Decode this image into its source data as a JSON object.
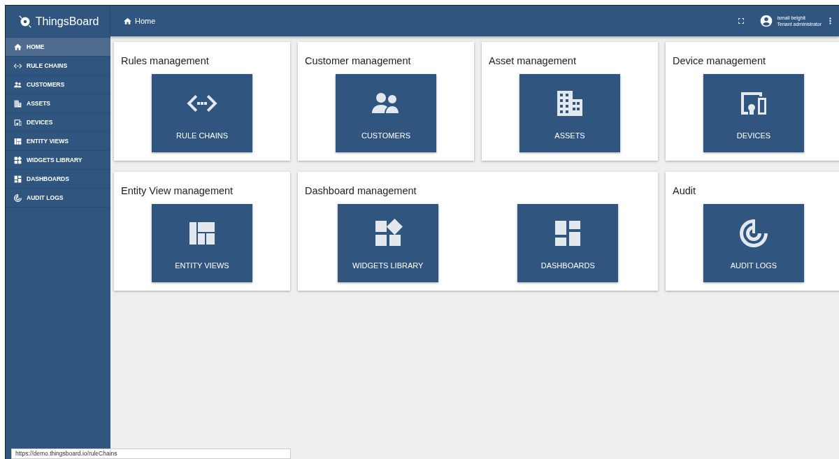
{
  "app": {
    "title": "ThingsBoard"
  },
  "breadcrumb": {
    "label": "Home"
  },
  "user": {
    "name": "ismail belghit",
    "role": "Tenant administrator"
  },
  "sidebar": {
    "items": [
      {
        "label": "HOME",
        "kind": "home",
        "selected": true
      },
      {
        "label": "RULE CHAINS",
        "kind": "code",
        "selected": false
      },
      {
        "label": "CUSTOMERS",
        "kind": "people",
        "selected": false
      },
      {
        "label": "ASSETS",
        "kind": "building",
        "selected": false
      },
      {
        "label": "DEVICES",
        "kind": "devices",
        "selected": false
      },
      {
        "label": "ENTITY VIEWS",
        "kind": "quilt",
        "selected": false
      },
      {
        "label": "WIDGETS LIBRARY",
        "kind": "widgets",
        "selected": false
      },
      {
        "label": "DASHBOARDS",
        "kind": "dashboard",
        "selected": false
      },
      {
        "label": "AUDIT LOGS",
        "kind": "track",
        "selected": false
      }
    ]
  },
  "cards": [
    {
      "title": "Rules management",
      "tiles": [
        {
          "label": "RULE CHAINS",
          "kind": "code"
        }
      ]
    },
    {
      "title": "Customer management",
      "tiles": [
        {
          "label": "CUSTOMERS",
          "kind": "people"
        }
      ]
    },
    {
      "title": "Asset management",
      "tiles": [
        {
          "label": "ASSETS",
          "kind": "building"
        }
      ]
    },
    {
      "title": "Device management",
      "tiles": [
        {
          "label": "DEVICES",
          "kind": "devices"
        }
      ]
    },
    {
      "title": "Entity View management",
      "tiles": [
        {
          "label": "ENTITY VIEWS",
          "kind": "quilt"
        }
      ]
    },
    {
      "title": "Dashboard management",
      "tiles": [
        {
          "label": "WIDGETS LIBRARY",
          "kind": "widgets"
        },
        {
          "label": "DASHBOARDS",
          "kind": "dashboard"
        }
      ]
    },
    {
      "title": "Audit",
      "tiles": [
        {
          "label": "AUDIT LOGS",
          "kind": "track"
        }
      ]
    }
  ],
  "status_url": "https://demo.thingsboard.io/ruleChains"
}
